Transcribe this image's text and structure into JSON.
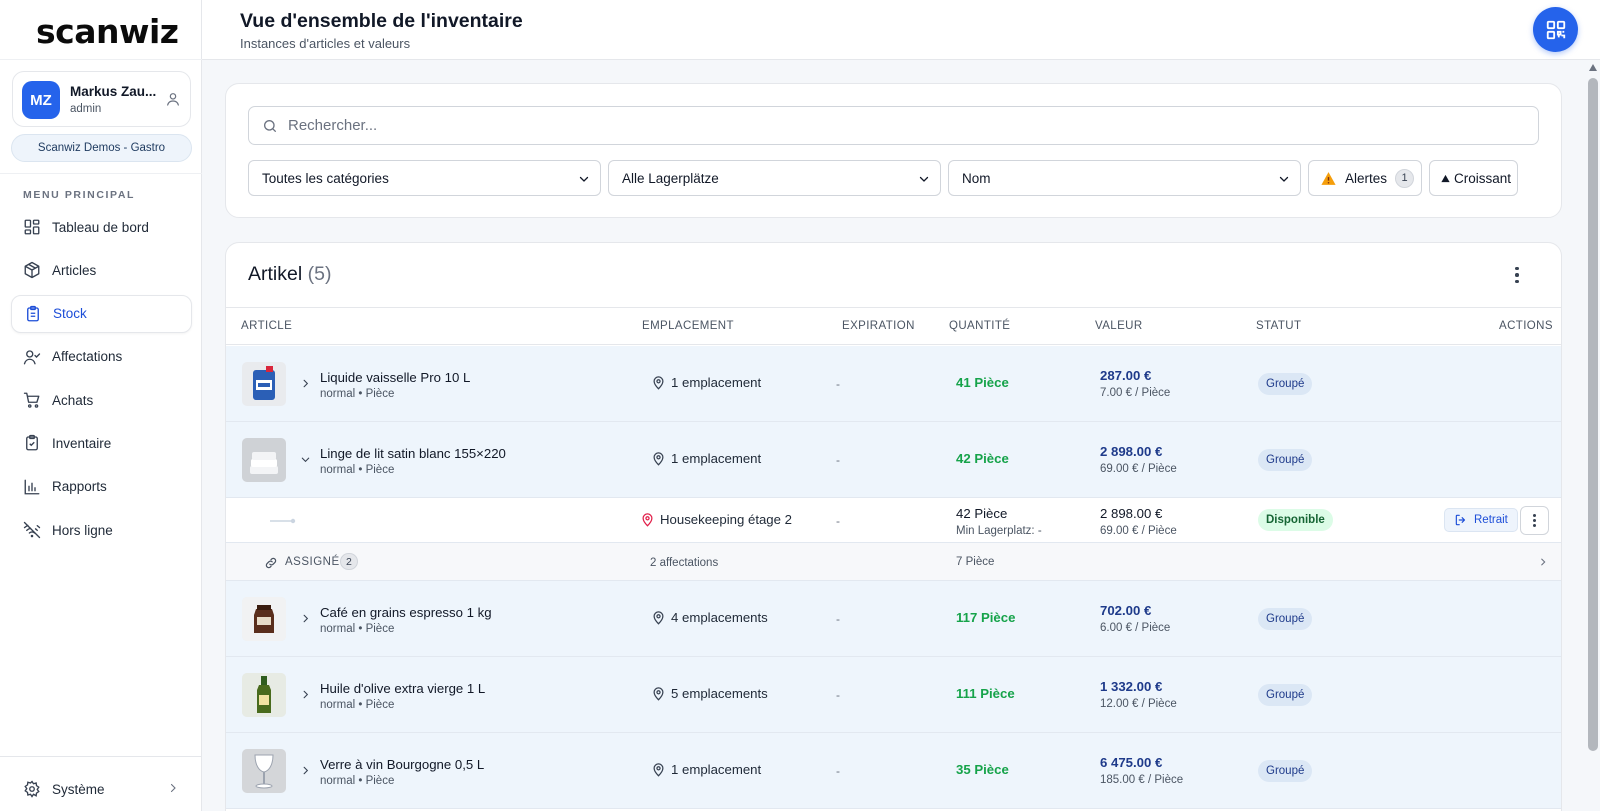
{
  "app": {
    "logo": "scanwiz",
    "user": {
      "initials": "MZ",
      "name": "Markus Zau...",
      "role": "admin"
    },
    "organization": "Scanwiz Demos - Gastro",
    "menu_heading": "MENU PRINCIPAL",
    "nav": [
      {
        "label": "Tableau de bord",
        "icon": "dashboard-icon"
      },
      {
        "label": "Articles",
        "icon": "box-icon"
      },
      {
        "label": "Stock",
        "icon": "clipboard-icon",
        "active": true
      },
      {
        "label": "Affectations",
        "icon": "user-check-icon"
      },
      {
        "label": "Achats",
        "icon": "cart-icon"
      },
      {
        "label": "Inventaire",
        "icon": "clipboard-check-icon"
      },
      {
        "label": "Rapports",
        "icon": "bar-chart-icon"
      },
      {
        "label": "Hors ligne",
        "icon": "wifi-off-icon"
      }
    ],
    "system_label": "Système"
  },
  "header": {
    "title": "Vue d'ensemble de l'inventaire",
    "subtitle": "Instances d'articles et valeurs"
  },
  "filters": {
    "search_placeholder": "Rechercher...",
    "category": "Toutes les catégories",
    "location": "Alle Lagerplätze",
    "sort_field": "Nom",
    "alerts_label": "Alertes",
    "alerts_count": "1",
    "order_label": "Croissant"
  },
  "table": {
    "title": "Artikel",
    "count": "(5)",
    "columns": {
      "article": "ARTICLE",
      "location": "EMPLACEMENT",
      "expiration": "EXPIRATION",
      "quantity": "QUANTITÉ",
      "value": "VALEUR",
      "status": "STATUT",
      "actions": "ACTIONS"
    },
    "rows": [
      {
        "name": "Liquide vaisselle Pro 10 L",
        "meta": "normal • Pièce",
        "location": "1 emplacement",
        "expiration": "-",
        "quantity": "41 Pièce",
        "value": "287.00 €",
        "unit_value": "7.00 € / Pièce",
        "status": "Groupé"
      },
      {
        "name": "Linge de lit satin blanc 155×220",
        "meta": "normal • Pièce",
        "location": "1 emplacement",
        "expiration": "-",
        "quantity": "42 Pièce",
        "value": "2 898.00 €",
        "unit_value": "69.00 € / Pièce",
        "status": "Groupé"
      },
      {
        "name": "Café en grains espresso 1 kg",
        "meta": "normal • Pièce",
        "location": "4 emplacements",
        "expiration": "-",
        "quantity": "117 Pièce",
        "value": "702.00 €",
        "unit_value": "6.00 € / Pièce",
        "status": "Groupé"
      },
      {
        "name": "Huile d'olive extra vierge 1 L",
        "meta": "normal • Pièce",
        "location": "5 emplacements",
        "expiration": "-",
        "quantity": "111 Pièce",
        "value": "1 332.00 €",
        "unit_value": "12.00 € / Pièce",
        "status": "Groupé"
      },
      {
        "name": "Verre à vin Bourgogne 0,5 L",
        "meta": "normal • Pièce",
        "location": "1 emplacement",
        "expiration": "-",
        "quantity": "35 Pièce",
        "value": "6 475.00 €",
        "unit_value": "185.00 € / Pièce",
        "status": "Groupé"
      }
    ],
    "expanded": {
      "location": "Housekeeping étage 2",
      "expiration": "-",
      "quantity": "42 Pièce",
      "min_info": "Min Lagerplatz: -",
      "value": "2 898.00 €",
      "unit_value": "69.00 € / Pièce",
      "status": "Disponible",
      "retrait_label": "Retrait"
    },
    "assigned": {
      "label": "ASSIGNÉ",
      "count": "2",
      "affectations": "2 affectations",
      "quantity": "7 Pièce"
    }
  },
  "colors": {
    "primary": "#2563eb",
    "row_highlight": "#eef5fc",
    "quantity_green": "#16a34a",
    "value_navy": "#1e3a8a",
    "available_green_bg": "#dcfce7"
  }
}
